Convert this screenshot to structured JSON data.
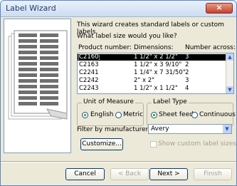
{
  "window": {
    "title": "Label Wizard",
    "close": "×"
  },
  "intro_text": "This wizard creates standard labels or custom labels.",
  "question": "What label size would you like?",
  "table": {
    "headers": [
      "Product number:",
      "Dimensions:",
      "Number across:"
    ],
    "rows": [
      [
        "C2160",
        "1 1/2\" x 2 1/2\"",
        "3"
      ],
      [
        "C2163",
        "1 1/2\" x 3 9/10\"",
        "2"
      ],
      [
        "C2241",
        "1 1/4\" x 7 31/50\"",
        "2"
      ],
      [
        "C2242",
        "2\" x 2\"",
        "3"
      ],
      [
        "C2243",
        "1 1/2\" x 1 1/2\"",
        "4"
      ]
    ],
    "selected_index": 0
  },
  "unit_of_measure": {
    "label": "Unit of Measure",
    "options": [
      "English",
      "Metric"
    ],
    "selected": "English"
  },
  "label_type": {
    "label": "Label Type",
    "options": [
      "Sheet feed",
      "Continuous"
    ],
    "selected": "Sheet feed"
  },
  "filter": {
    "label": "Filter by  manufacturer:",
    "value": "Avery"
  },
  "customize_button": "Customize...",
  "show_custom_sizes": "Show custom label sizes",
  "buttons": {
    "cancel": "Cancel",
    "back": "< Back",
    "next": "Next >",
    "finish": "Finish"
  },
  "icons": {
    "close": "close-icon",
    "scroll_up": "scroll-up-icon",
    "scroll_down": "scroll-down-icon",
    "dropdown": "chevron-down-icon"
  }
}
